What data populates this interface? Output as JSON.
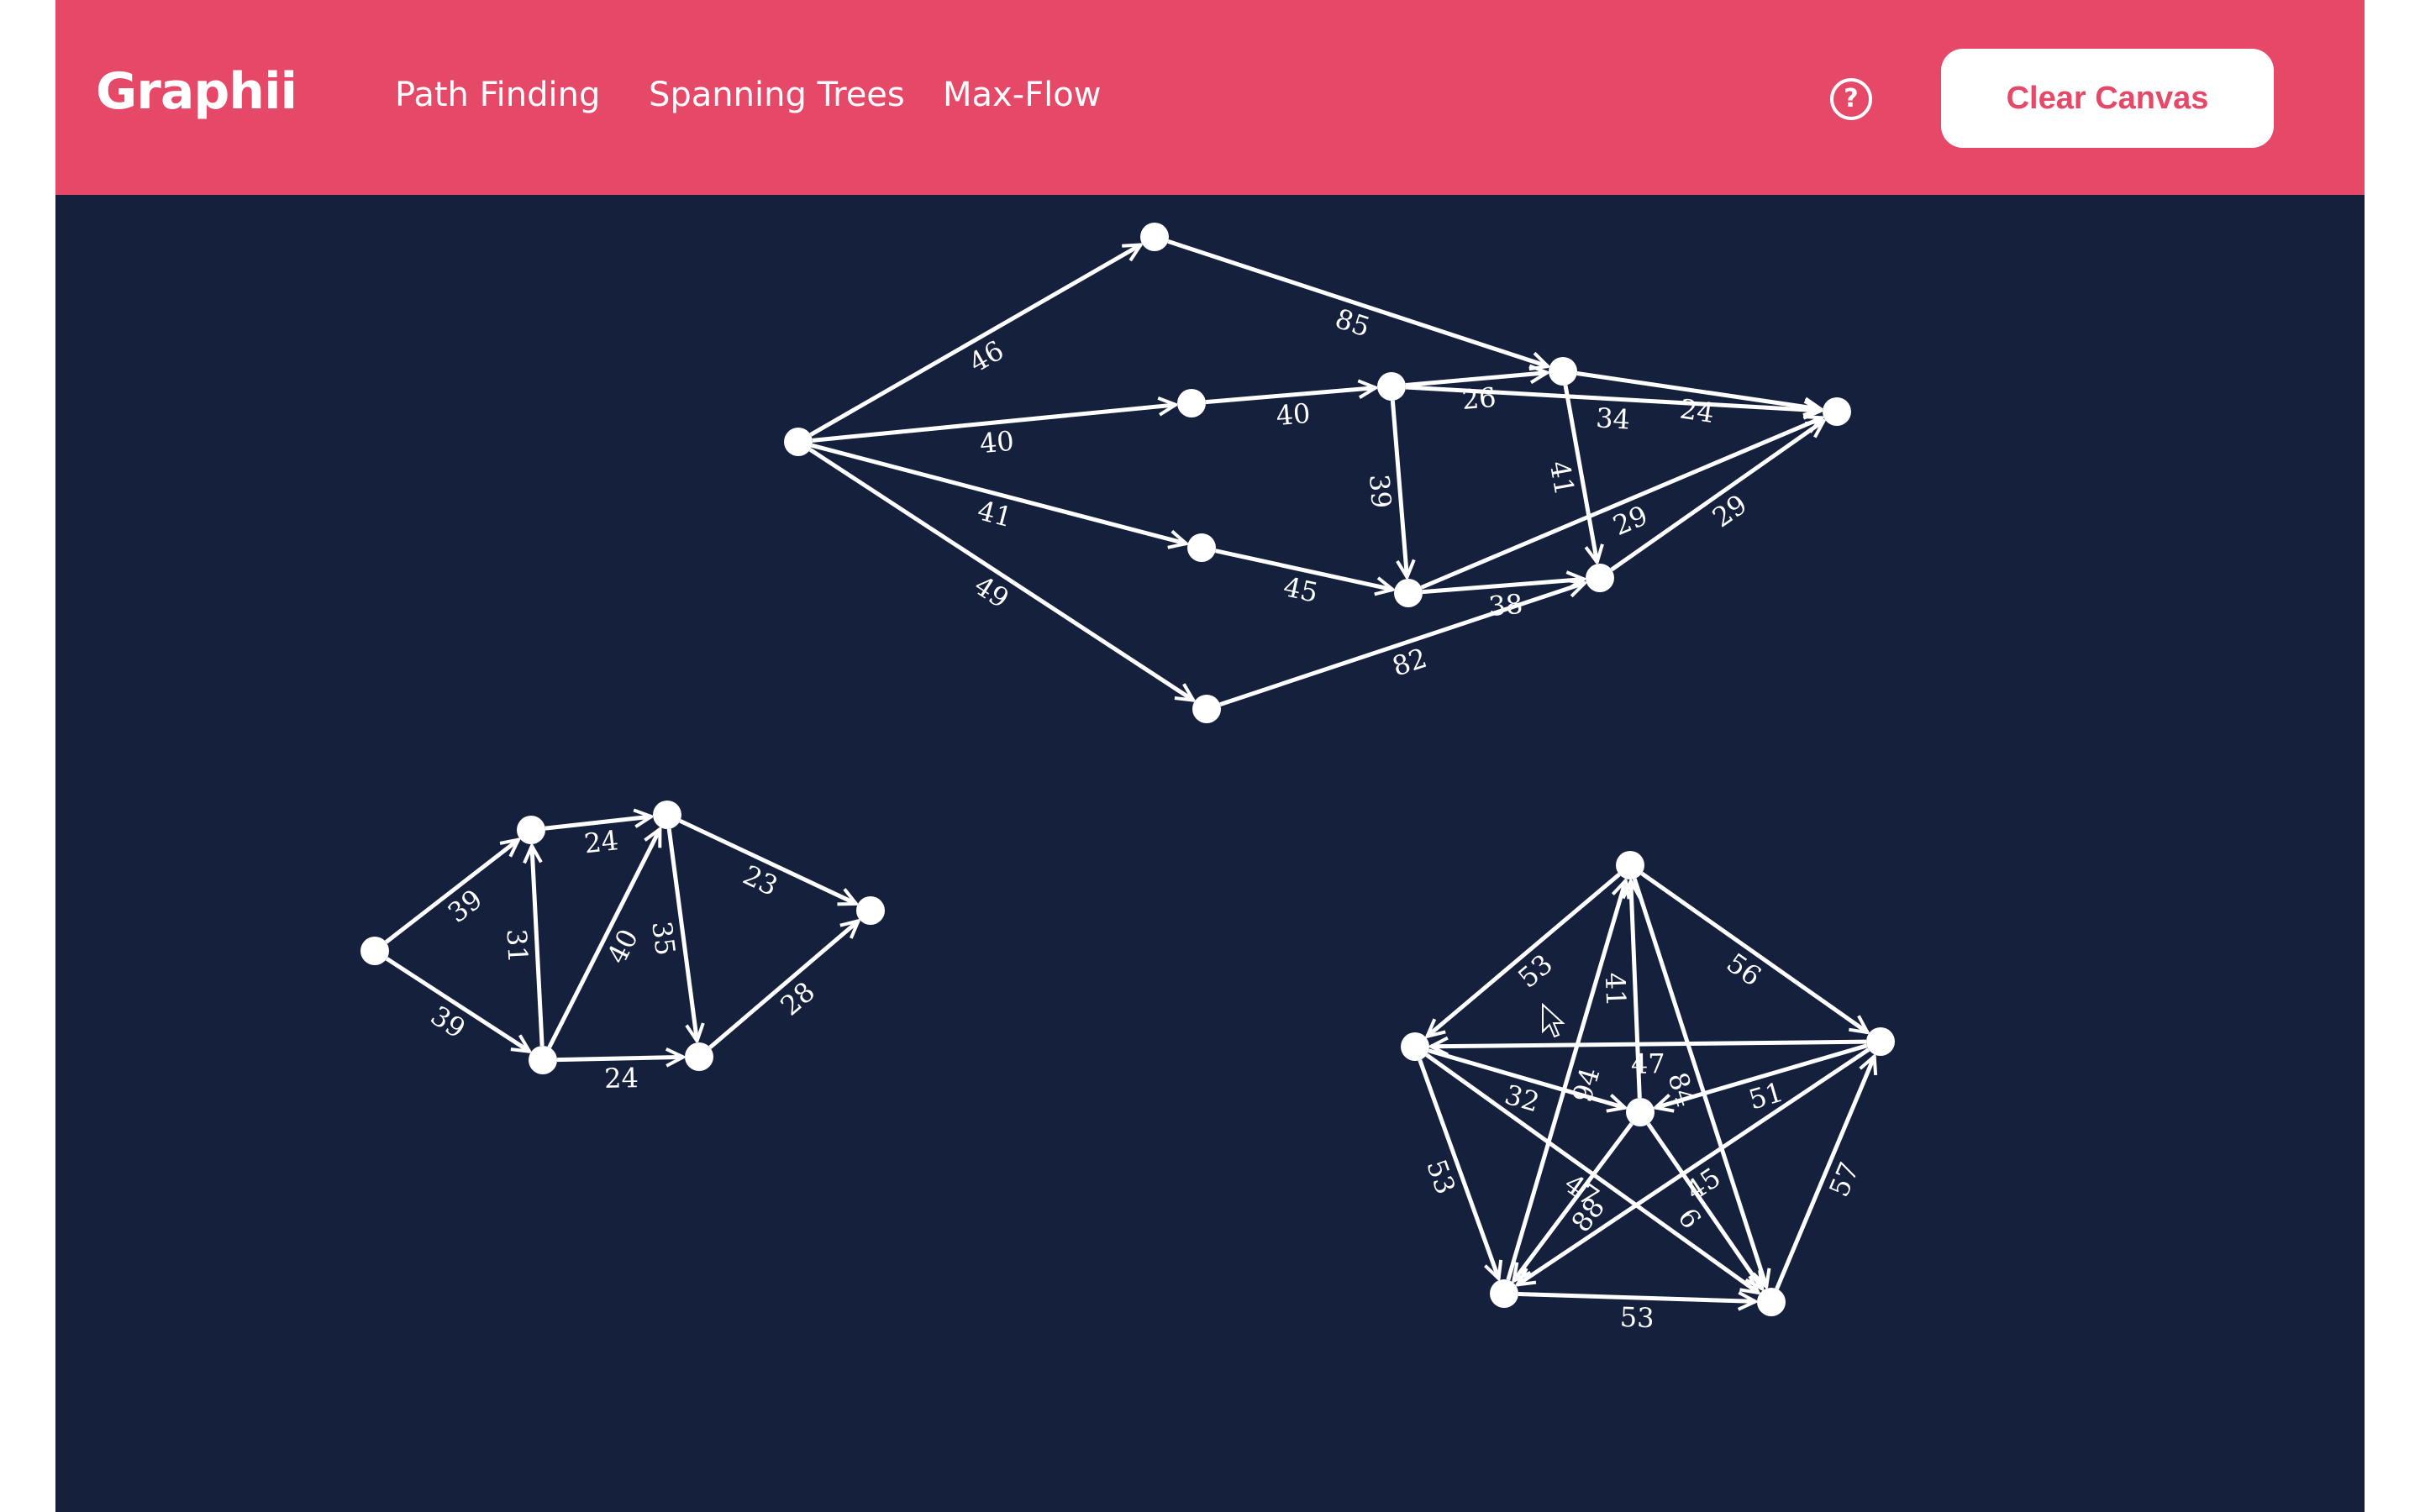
{
  "app": {
    "brand": "Graphii"
  },
  "nav": {
    "path_finding": "Path Finding",
    "spanning_trees": "Spanning Trees",
    "max_flow": "Max-Flow"
  },
  "header": {
    "help_icon": "question-circle-icon",
    "help_glyph": "?",
    "clear_label": "Clear Canvas"
  },
  "colors": {
    "header": "#e64868",
    "canvas": "#14203c",
    "graph": "#ffffff"
  },
  "graphs": [
    {
      "name": "graph-top",
      "edges": [
        {
          "from": "A",
          "to": "B",
          "weight": "46"
        },
        {
          "from": "B",
          "to": "F",
          "weight": "85"
        },
        {
          "from": "A",
          "to": "C",
          "weight": "40"
        },
        {
          "from": "C",
          "to": "D",
          "weight": "40"
        },
        {
          "from": "D",
          "to": "F",
          "weight": "26"
        },
        {
          "from": "D",
          "to": "G",
          "weight": "34"
        },
        {
          "from": "F",
          "to": "G",
          "weight": "24"
        },
        {
          "from": "A",
          "to": "E",
          "weight": "41"
        },
        {
          "from": "E",
          "to": "H",
          "weight": "45"
        },
        {
          "from": "A",
          "to": "J",
          "weight": "49"
        },
        {
          "from": "D",
          "to": "H",
          "weight": "39"
        },
        {
          "from": "F",
          "to": "I",
          "weight": "41"
        },
        {
          "from": "H",
          "to": "G",
          "weight": "29"
        },
        {
          "from": "I",
          "to": "G",
          "weight": "29"
        },
        {
          "from": "H",
          "to": "I",
          "weight": "38"
        },
        {
          "from": "J",
          "to": "I",
          "weight": "82"
        }
      ]
    },
    {
      "name": "graph-left",
      "edges": [
        {
          "from": "K",
          "to": "L",
          "weight": "39"
        },
        {
          "from": "K",
          "to": "N",
          "weight": "39"
        },
        {
          "from": "L",
          "to": "M",
          "weight": "24"
        },
        {
          "from": "N",
          "to": "L",
          "weight": "31"
        },
        {
          "from": "N",
          "to": "M",
          "weight": "40"
        },
        {
          "from": "M",
          "to": "O",
          "weight": "35"
        },
        {
          "from": "M",
          "to": "P",
          "weight": "23"
        },
        {
          "from": "N",
          "to": "O",
          "weight": "24"
        },
        {
          "from": "O",
          "to": "P",
          "weight": "28"
        }
      ]
    },
    {
      "name": "graph-right",
      "edges": [
        {
          "from": "Q",
          "to": "R",
          "weight": "53"
        },
        {
          "from": "Q",
          "to": "S",
          "weight": "56"
        },
        {
          "from": "S",
          "to": "R",
          "weight": "47"
        },
        {
          "from": "T",
          "to": "Q",
          "weight": "41"
        },
        {
          "from": "R",
          "to": "U",
          "weight": "53"
        },
        {
          "from": "U",
          "to": "V",
          "weight": "53"
        },
        {
          "from": "V",
          "to": "S",
          "weight": "57"
        },
        {
          "from": "R",
          "to": "T",
          "weight": "32"
        },
        {
          "from": "S",
          "to": "T",
          "weight": "51"
        },
        {
          "from": "T",
          "to": "U",
          "weight": "88"
        },
        {
          "from": "T",
          "to": "V",
          "weight": "6"
        },
        {
          "from": "Q",
          "to": "V",
          "weight": "84"
        },
        {
          "from": "U",
          "to": "Q",
          "weight": "94"
        },
        {
          "from": "S",
          "to": "U",
          "weight": "45"
        },
        {
          "from": "R",
          "to": "V",
          "weight": "47"
        }
      ]
    }
  ]
}
